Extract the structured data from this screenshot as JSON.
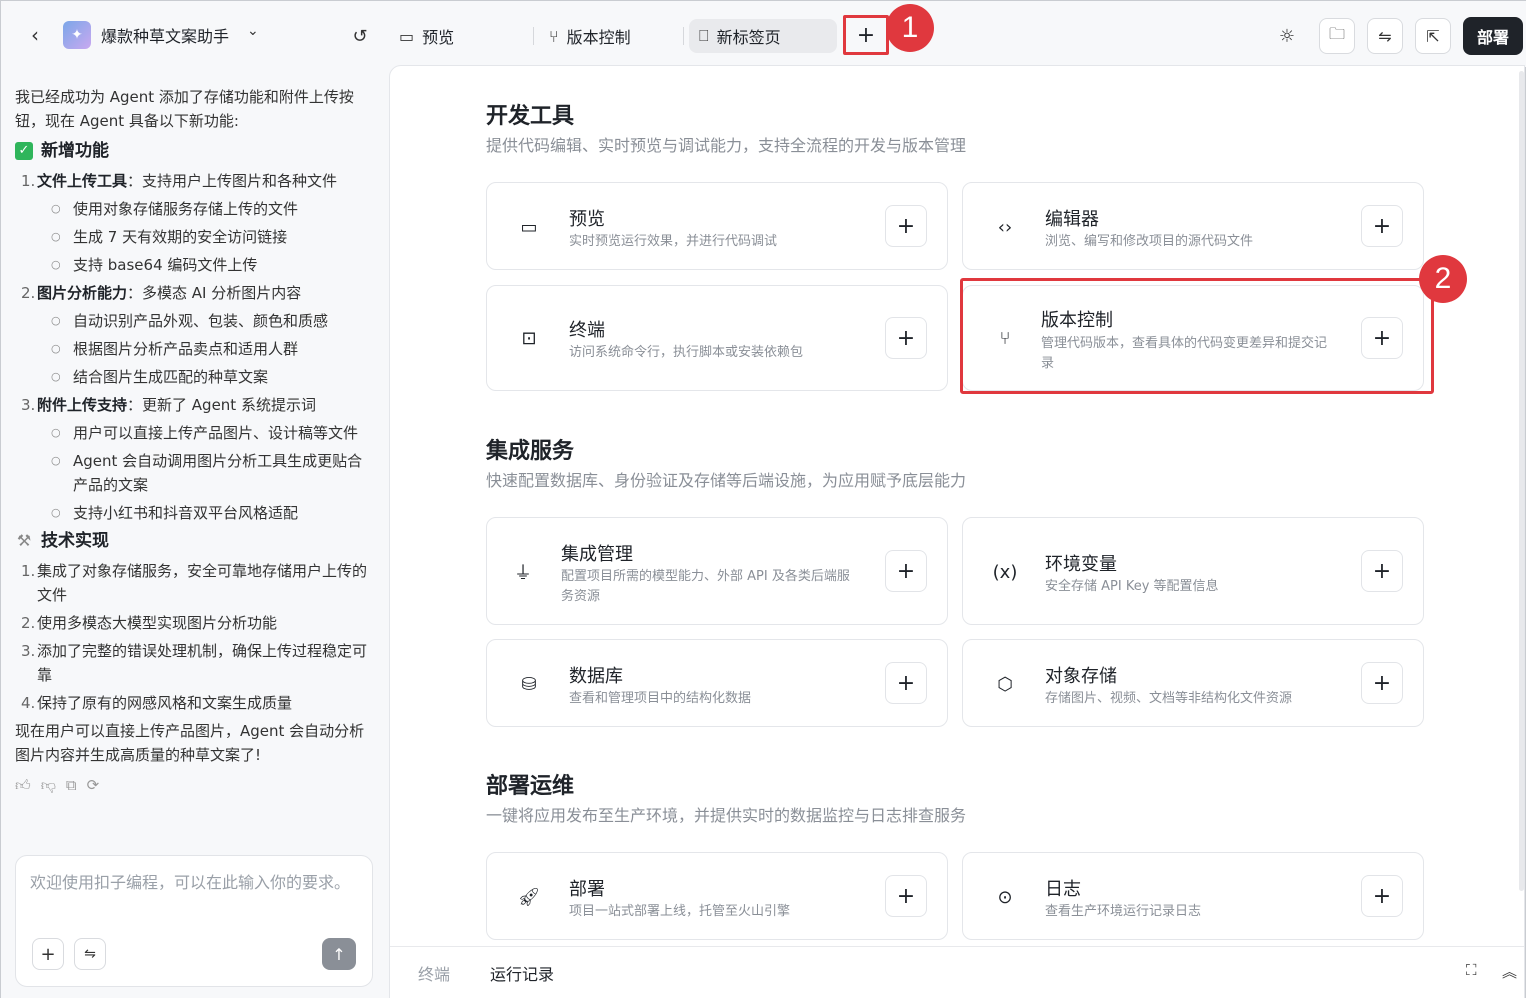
{
  "topbar": {
    "app_name": "爆款种草文案助手",
    "tabs": [
      {
        "label": "预览"
      },
      {
        "label": "版本控制"
      },
      {
        "label": "新标签页"
      }
    ],
    "add_tab": "+",
    "deploy_label": "部署"
  },
  "annotations": {
    "badge1": "1",
    "badge2": "2"
  },
  "chat": {
    "intro": "我已经成功为 Agent 添加了存储功能和附件上传按钮，现在 Agent 具备以下新功能:",
    "new_features_title": "新增功能",
    "features": [
      {
        "num": "1.",
        "title": "文件上传工具",
        "desc": "：支持用户上传图片和各种文件",
        "bullets": [
          "使用对象存储服务存储上传的文件",
          "生成 7 天有效期的安全访问链接",
          "支持 base64 编码文件上传"
        ]
      },
      {
        "num": "2.",
        "title": "图片分析能力",
        "desc": "：多模态 AI 分析图片内容",
        "bullets": [
          "自动识别产品外观、包装、颜色和质感",
          "根据图片分析产品卖点和适用人群",
          "结合图片生成匹配的种草文案"
        ]
      },
      {
        "num": "3.",
        "title": "附件上传支持",
        "desc": "：更新了 Agent 系统提示词",
        "bullets": [
          "用户可以直接上传产品图片、设计稿等文件",
          "Agent 会自动调用图片分析工具生成更贴合产品的文案",
          "支持小红书和抖音双平台风格适配"
        ]
      }
    ],
    "tech_title": "技术实现",
    "tech": [
      {
        "num": "1.",
        "text": "集成了对象存储服务，安全可靠地存储用户上传的文件"
      },
      {
        "num": "2.",
        "text": "使用多模态大模型实现图片分析功能"
      },
      {
        "num": "3.",
        "text": "添加了完整的错误处理机制，确保上传过程稳定可靠"
      },
      {
        "num": "4.",
        "text": "保持了原有的网感风格和文案生成质量"
      }
    ],
    "outro": "现在用户可以直接上传产品图片，Agent 会自动分析图片内容并生成高质量的种草文案了!",
    "input_placeholder": "欢迎使用扣子编程，可以在此输入你的要求。"
  },
  "main": {
    "sections": [
      {
        "title": "开发工具",
        "subtitle": "提供代码编辑、实时预览与调试能力，支持全流程的开发与版本管理",
        "cards": [
          {
            "title": "预览",
            "desc": "实时预览运行效果，并进行代码调试"
          },
          {
            "title": "编辑器",
            "desc": "浏览、编写和修改项目的源代码文件"
          },
          {
            "title": "终端",
            "desc": "访问系统命令行，执行脚本或安装依赖包"
          },
          {
            "title": "版本控制",
            "desc": "管理代码版本，查看具体的代码变更差异和提交记录"
          }
        ]
      },
      {
        "title": "集成服务",
        "subtitle": "快速配置数据库、身份验证及存储等后端设施，为应用赋予底层能力",
        "cards": [
          {
            "title": "集成管理",
            "desc": "配置项目所需的模型能力、外部 API 及各类后端服务资源"
          },
          {
            "title": "环境变量",
            "desc": "安全存储 API Key 等配置信息"
          },
          {
            "title": "数据库",
            "desc": "查看和管理项目中的结构化数据"
          },
          {
            "title": "对象存储",
            "desc": "存储图片、视频、文档等非结构化文件资源"
          }
        ]
      },
      {
        "title": "部署运维",
        "subtitle": "一键将应用发布至生产环境，并提供实时的数据监控与日志排查服务",
        "cards": [
          {
            "title": "部署",
            "desc": "项目一站式部署上线，托管至火山引擎"
          },
          {
            "title": "日志",
            "desc": "查看生产环境运行记录日志"
          }
        ]
      }
    ],
    "bottom_tabs": [
      "终端",
      "运行记录"
    ]
  }
}
